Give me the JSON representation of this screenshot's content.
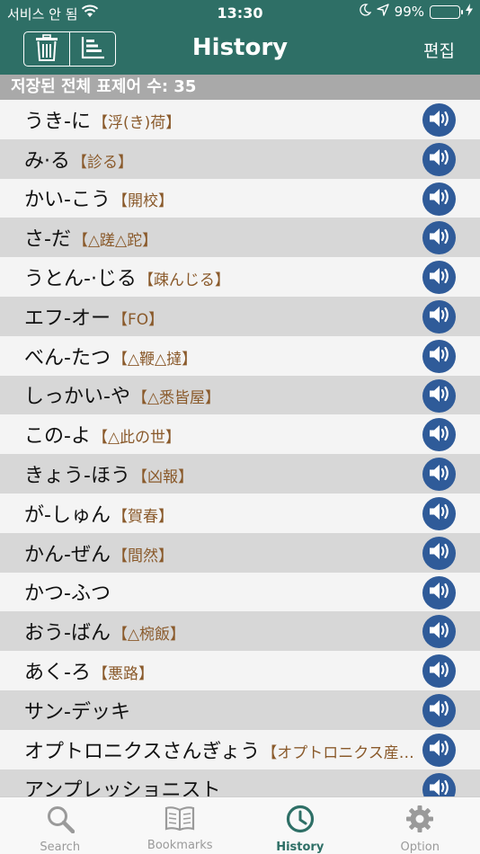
{
  "status": {
    "carrier": "서비스 안 됨",
    "time": "13:30",
    "battery": "99%"
  },
  "nav": {
    "title": "History",
    "edit_label": "편집"
  },
  "count_text": "저장된 전체 표제어 수: 35",
  "entries": [
    {
      "head": "うき-に",
      "kanji": "【浮(き)荷】"
    },
    {
      "head": "み·る",
      "kanji": "【診る】"
    },
    {
      "head": "かい-こう",
      "kanji": "【開校】"
    },
    {
      "head": "さ-だ",
      "kanji": "【△蹉△跎】"
    },
    {
      "head": "うとん-·じる",
      "kanji": "【疎んじる】"
    },
    {
      "head": "エフ-オー",
      "kanji": "【FO】"
    },
    {
      "head": "べん-たつ",
      "kanji": "【△鞭△撻】"
    },
    {
      "head": "しっかい-や",
      "kanji": "【△悉皆屋】"
    },
    {
      "head": "この-よ",
      "kanji": "【△此の世】"
    },
    {
      "head": "きょう-ほう",
      "kanji": "【凶報】"
    },
    {
      "head": "が-しゅん",
      "kanji": "【賀春】"
    },
    {
      "head": "かん-ぜん",
      "kanji": "【間然】"
    },
    {
      "head": "かつ-ふつ",
      "kanji": ""
    },
    {
      "head": "おう-ばん",
      "kanji": "【△椀飯】"
    },
    {
      "head": "あく-ろ",
      "kanji": "【悪路】"
    },
    {
      "head": "サン-デッキ",
      "kanji": ""
    },
    {
      "head": "オプトロニクスさんぎょう",
      "kanji": "【オプトロニクス産…"
    },
    {
      "head": "アンプレッショニスト",
      "kanji": ""
    }
  ],
  "tabs": [
    {
      "label": "Search",
      "icon": "search-icon",
      "active": false
    },
    {
      "label": "Bookmarks",
      "icon": "book-icon",
      "active": false
    },
    {
      "label": "History",
      "icon": "clock-icon",
      "active": true
    },
    {
      "label": "Option",
      "icon": "gear-icon",
      "active": false
    }
  ],
  "colors": {
    "header": "#2e6f66",
    "speaker": "#2f5b99",
    "kanji": "#8a5a2b"
  }
}
